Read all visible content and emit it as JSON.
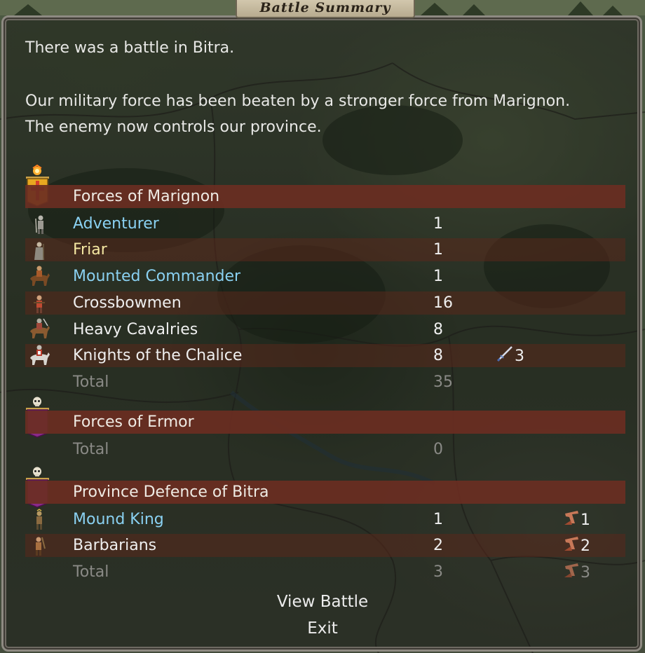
{
  "title": "Battle Summary",
  "message": {
    "line1": "There was a battle in Bitra.",
    "line2": "Our military force has been beaten by a stronger force from Marignon. The enemy now controls our province."
  },
  "groups": {
    "marignon": {
      "header": "Forces of Marignon",
      "rows": [
        {
          "name": "Adventurer",
          "count": "1"
        },
        {
          "name": "Friar",
          "count": "1"
        },
        {
          "name": "Mounted Commander",
          "count": "1"
        },
        {
          "name": "Crossbowmen",
          "count": "16"
        },
        {
          "name": "Heavy Cavalries",
          "count": "8"
        },
        {
          "name": "Knights of the Chalice",
          "count": "8",
          "extra": "3",
          "extra_icon": "sword-icon"
        }
      ],
      "total_label": "Total",
      "total": "35"
    },
    "ermor": {
      "header": "Forces of Ermor",
      "total_label": "Total",
      "total": "0"
    },
    "bitra": {
      "header": "Province Defence of Bitra",
      "rows": [
        {
          "name": "Mound King",
          "count": "1",
          "extra": "1",
          "extra_icon": "slain-icon"
        },
        {
          "name": "Barbarians",
          "count": "2",
          "extra": "2",
          "extra_icon": "slain-icon"
        }
      ],
      "total_label": "Total",
      "total": "3",
      "total_extra": "3"
    }
  },
  "buttons": {
    "view_battle": "View Battle",
    "exit": "Exit"
  },
  "colors": {
    "commander_blue": "#8ad1f2",
    "priest_yellow": "#f4e7a2",
    "header_red": "#6a2e22",
    "total_grey": "#8a8a86"
  }
}
